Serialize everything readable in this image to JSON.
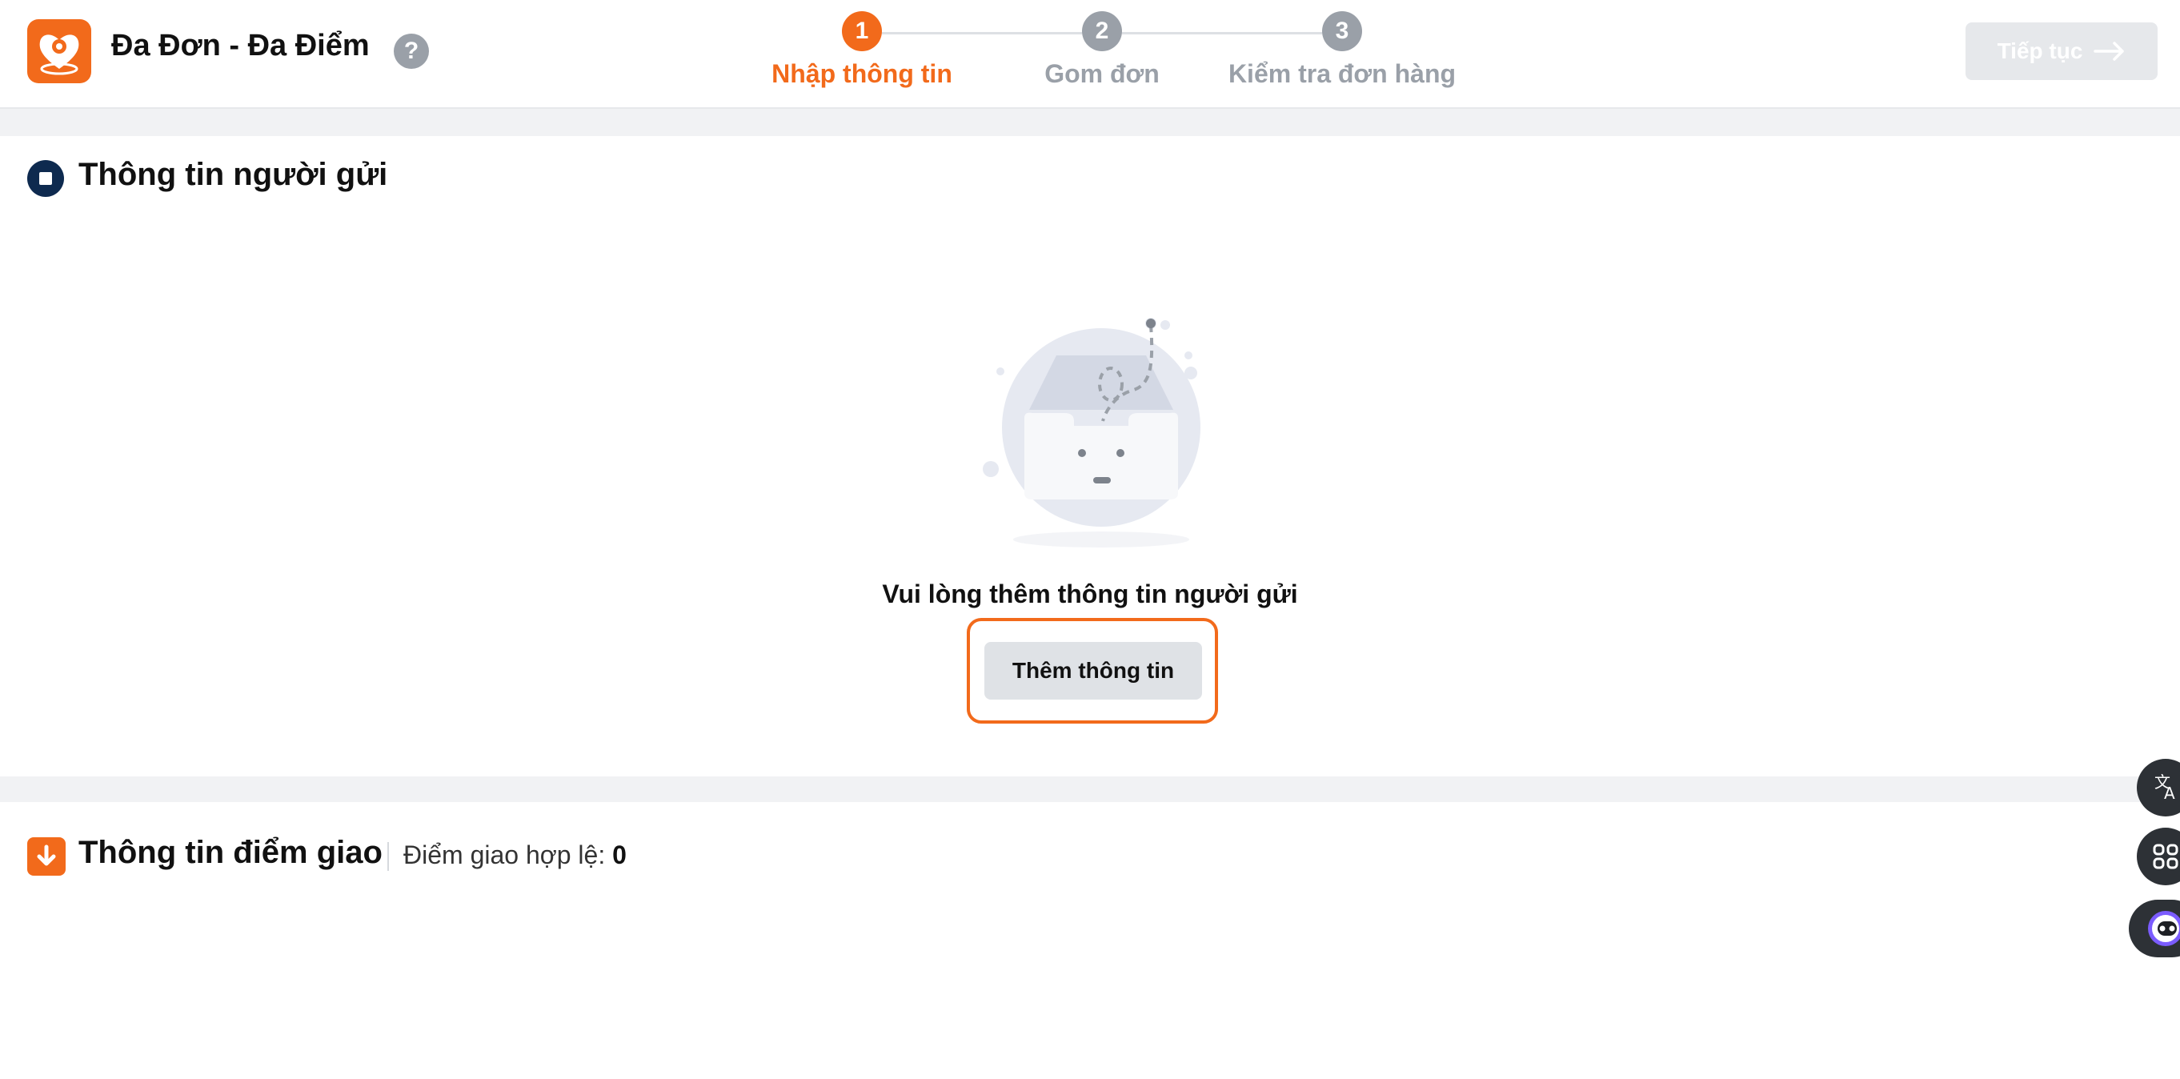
{
  "header": {
    "app_title": "Đa Đơn - Đa Điểm",
    "help_glyph": "?",
    "continue_label": "Tiếp tục",
    "steps": [
      {
        "number": "1",
        "label": "Nhập thông tin",
        "active": true
      },
      {
        "number": "2",
        "label": "Gom đơn",
        "active": false
      },
      {
        "number": "3",
        "label": "Kiểm tra đơn hàng",
        "active": false
      }
    ]
  },
  "sender": {
    "title": "Thông tin người gửi",
    "empty_message": "Vui lòng thêm thông tin người gửi",
    "add_button_label": "Thêm thông tin"
  },
  "delivery": {
    "title": "Thông tin điểm giao",
    "valid_points_label": "Điểm giao hợp lệ:",
    "valid_points_count": "0"
  },
  "icons": {
    "logo": "heart-location-logo-icon",
    "sender": "circle-square-icon",
    "delivery": "arrow-down-icon",
    "translate": "translate-icon",
    "apps": "command-icon",
    "assistant": "robot-face-icon"
  },
  "colors": {
    "accent": "#f26a1b",
    "navy": "#0e2a4f",
    "muted": "#9aa0a8",
    "disabled_button": "#e6e8eb"
  }
}
